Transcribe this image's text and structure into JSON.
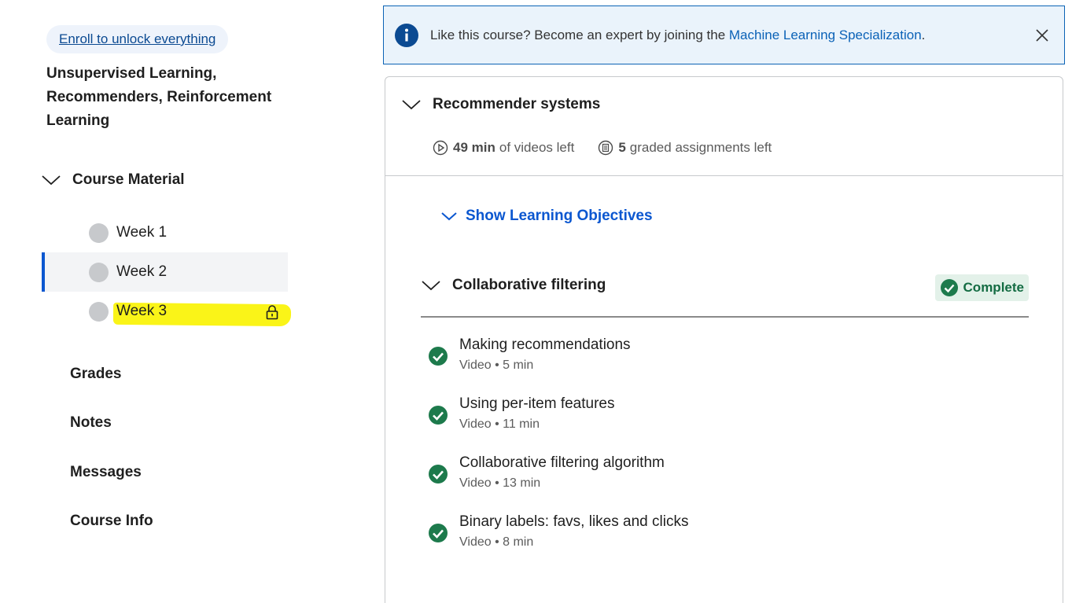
{
  "sidebar": {
    "enroll_link": "Enroll to unlock everything",
    "course_title": "Unsupervised Learning, Recommenders, Reinforcement Learning",
    "section_label": "Course Material",
    "weeks": [
      {
        "label": "Week 1",
        "state": "default"
      },
      {
        "label": "Week 2",
        "state": "active"
      },
      {
        "label": "Week 3",
        "state": "locked"
      }
    ],
    "nav": [
      "Grades",
      "Notes",
      "Messages",
      "Course Info"
    ]
  },
  "banner": {
    "text": "Like this course? Become an expert by joining the ",
    "link": "Machine Learning Specialization",
    "suffix": "."
  },
  "module": {
    "title": "Recommender systems",
    "videos_left_value": "49 min",
    "videos_left_text": "of videos left",
    "assignments_left_value": "5",
    "assignments_left_text": "graded assignments left",
    "objectives_label": "Show Learning Objectives",
    "lesson": {
      "title": "Collaborative filtering",
      "status": "Complete",
      "items": [
        {
          "title": "Making recommendations",
          "meta": "Video • 5 min"
        },
        {
          "title": "Using per-item features",
          "meta": "Video • 11 min"
        },
        {
          "title": "Collaborative filtering algorithm",
          "meta": "Video • 13 min"
        },
        {
          "title": "Binary labels: favs, likes and clicks",
          "meta": "Video • 8 min"
        }
      ]
    }
  },
  "colors": {
    "accent_blue": "#0b57d0",
    "complete_green": "#1d7a4c",
    "highlight_yellow": "#faf418"
  }
}
